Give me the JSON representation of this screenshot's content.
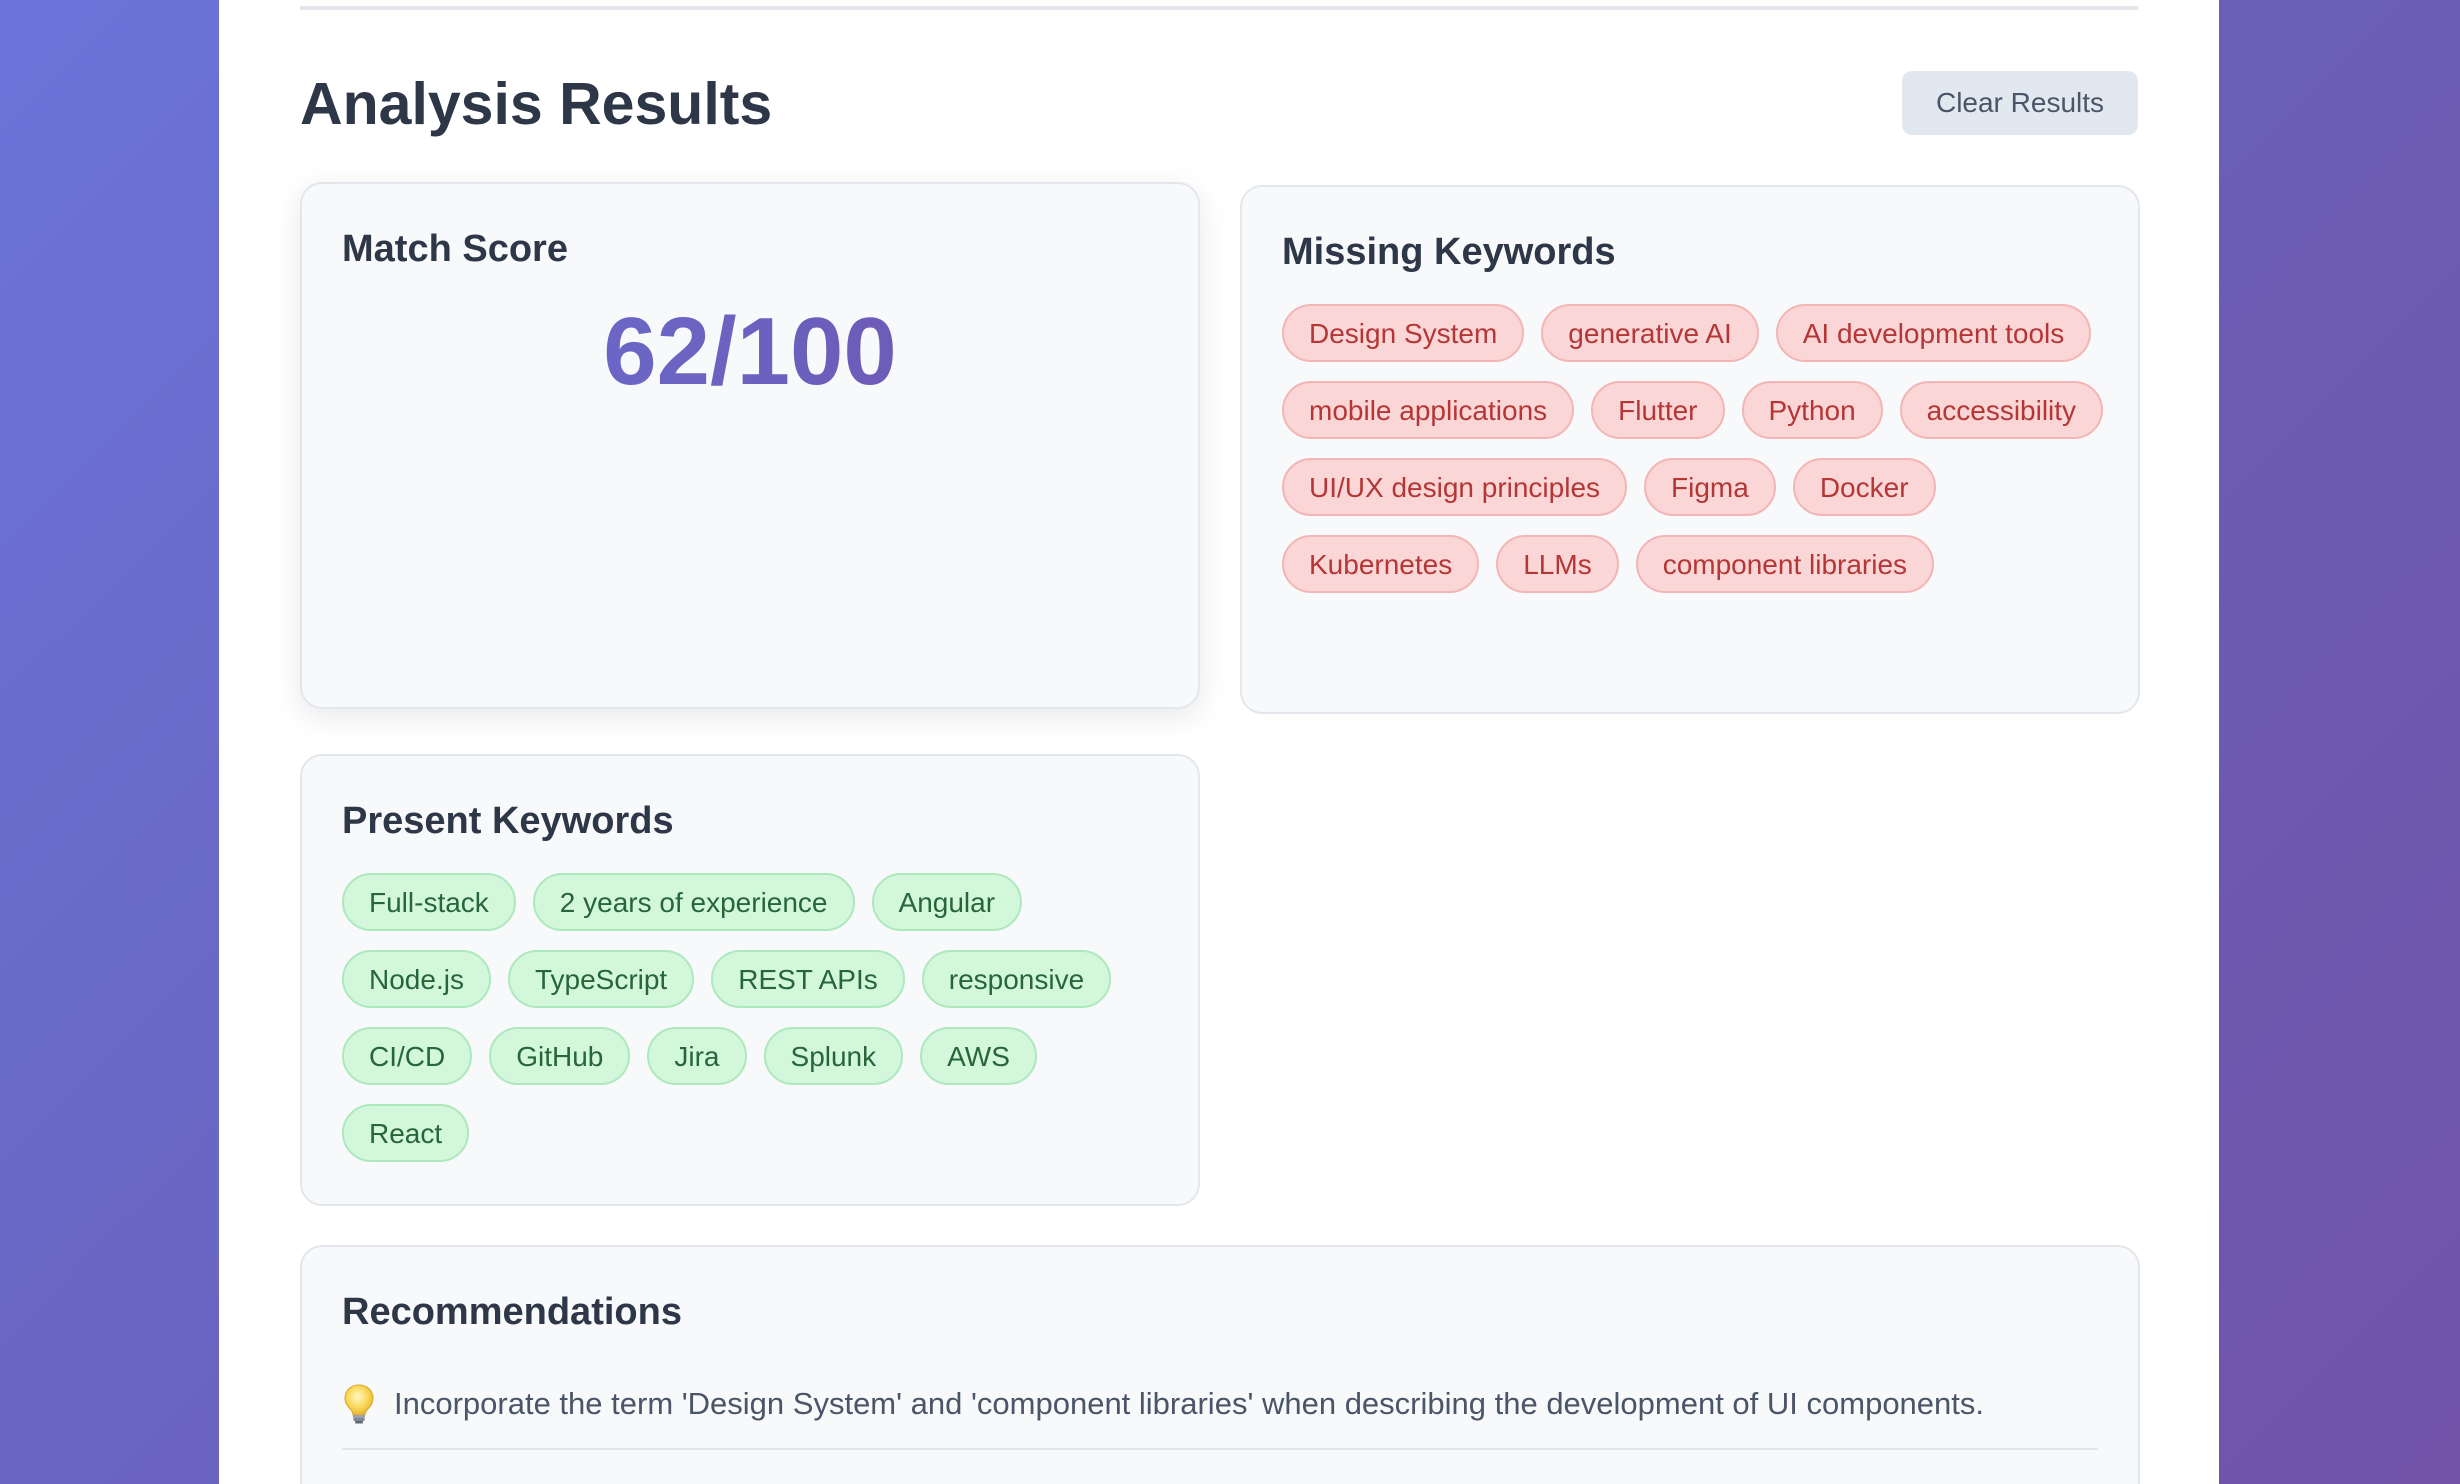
{
  "header": {
    "title": "Analysis Results",
    "clear_button_label": "Clear Results"
  },
  "match_score": {
    "title": "Match Score",
    "score_text": "62/100",
    "score": 62,
    "max": 100
  },
  "missing_keywords": {
    "title": "Missing Keywords",
    "items": [
      "Design System",
      "generative AI",
      "AI development tools",
      "mobile applications",
      "Flutter",
      "Python",
      "accessibility",
      "UI/UX design principles",
      "Figma",
      "Docker",
      "Kubernetes",
      "LLMs",
      "component libraries"
    ]
  },
  "present_keywords": {
    "title": "Present Keywords",
    "items": [
      "Full-stack",
      "2 years of experience",
      "Angular",
      "Node.js",
      "TypeScript",
      "REST APIs",
      "responsive",
      "CI/CD",
      "GitHub",
      "Jira",
      "Splunk",
      "AWS",
      "React"
    ]
  },
  "recommendations": {
    "title": "Recommendations",
    "items": [
      {
        "icon": "lightbulb-icon",
        "text": "Incorporate the term 'Design System' and 'component libraries' when describing the development of UI components."
      }
    ]
  },
  "colors": {
    "score_gradient_start": "#6872d6",
    "score_gradient_end": "#7050a8",
    "missing_tag_bg": "#fbd6d6",
    "missing_tag_text": "#b53636",
    "present_tag_bg": "#d3f7db",
    "present_tag_text": "#276639"
  }
}
